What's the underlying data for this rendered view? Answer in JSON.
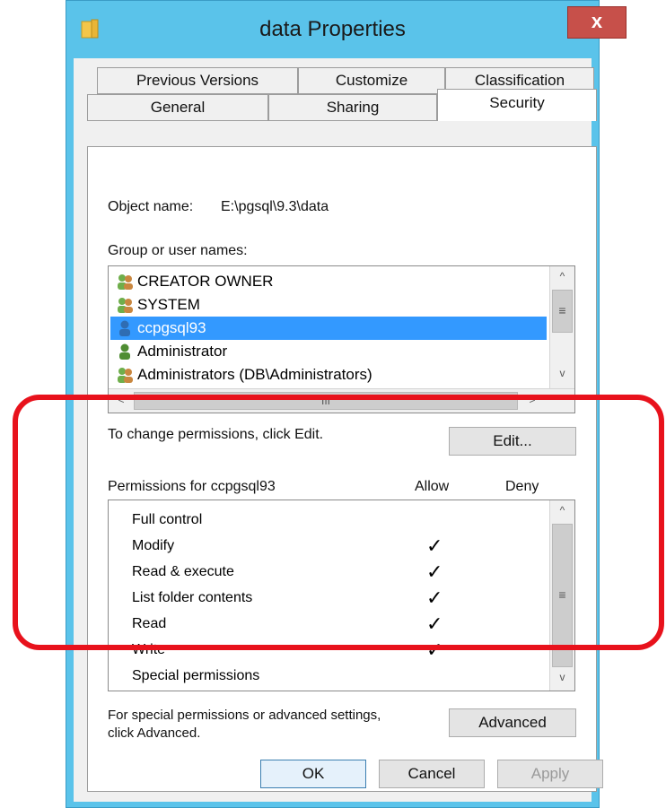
{
  "window": {
    "title": "data Properties",
    "close_label": "x"
  },
  "tabs": {
    "top_row": [
      "Previous Versions",
      "Customize",
      "Classification"
    ],
    "bottom_row": [
      "General",
      "Sharing",
      "Security"
    ],
    "active": "Security"
  },
  "security": {
    "object_name_label": "Object name:",
    "object_name_value": "E:\\pgsql\\9.3\\data",
    "group_label": "Group or user names:",
    "users": [
      {
        "name": "CREATOR OWNER",
        "icon": "group-icon"
      },
      {
        "name": "SYSTEM",
        "icon": "group-icon"
      },
      {
        "name": "ccpgsql93",
        "icon": "user-icon",
        "selected": true
      },
      {
        "name": "Administrator",
        "icon": "user-icon"
      },
      {
        "name": "Administrators (DB\\Administrators)",
        "icon": "group-icon"
      }
    ],
    "change_hint": "To change permissions, click Edit.",
    "edit_label": "Edit...",
    "permissions_label": "Permissions for ccpgsql93",
    "allow_label": "Allow",
    "deny_label": "Deny",
    "permissions": [
      {
        "name": "Full control",
        "allow": false,
        "deny": false
      },
      {
        "name": "Modify",
        "allow": true,
        "deny": false
      },
      {
        "name": "Read & execute",
        "allow": true,
        "deny": false
      },
      {
        "name": "List folder contents",
        "allow": true,
        "deny": false
      },
      {
        "name": "Read",
        "allow": true,
        "deny": false
      },
      {
        "name": "Write",
        "allow": true,
        "deny": false
      },
      {
        "name": "Special permissions",
        "allow": false,
        "deny": false
      }
    ],
    "advanced_hint_line1": "For special permissions or advanced settings,",
    "advanced_hint_line2": "click Advanced.",
    "advanced_label": "Advanced"
  },
  "footer": {
    "ok_label": "OK",
    "cancel_label": "Cancel",
    "apply_label": "Apply"
  },
  "colors": {
    "title_bar": "#5ac3ea",
    "selection": "#3399ff",
    "callout": "#e8121c",
    "close_button": "#c7504a"
  },
  "glyphs": {
    "check": "✓",
    "up": "^",
    "down": "v",
    "left": "<",
    "right": ">",
    "grip": "≡",
    "hgrip": "III"
  }
}
